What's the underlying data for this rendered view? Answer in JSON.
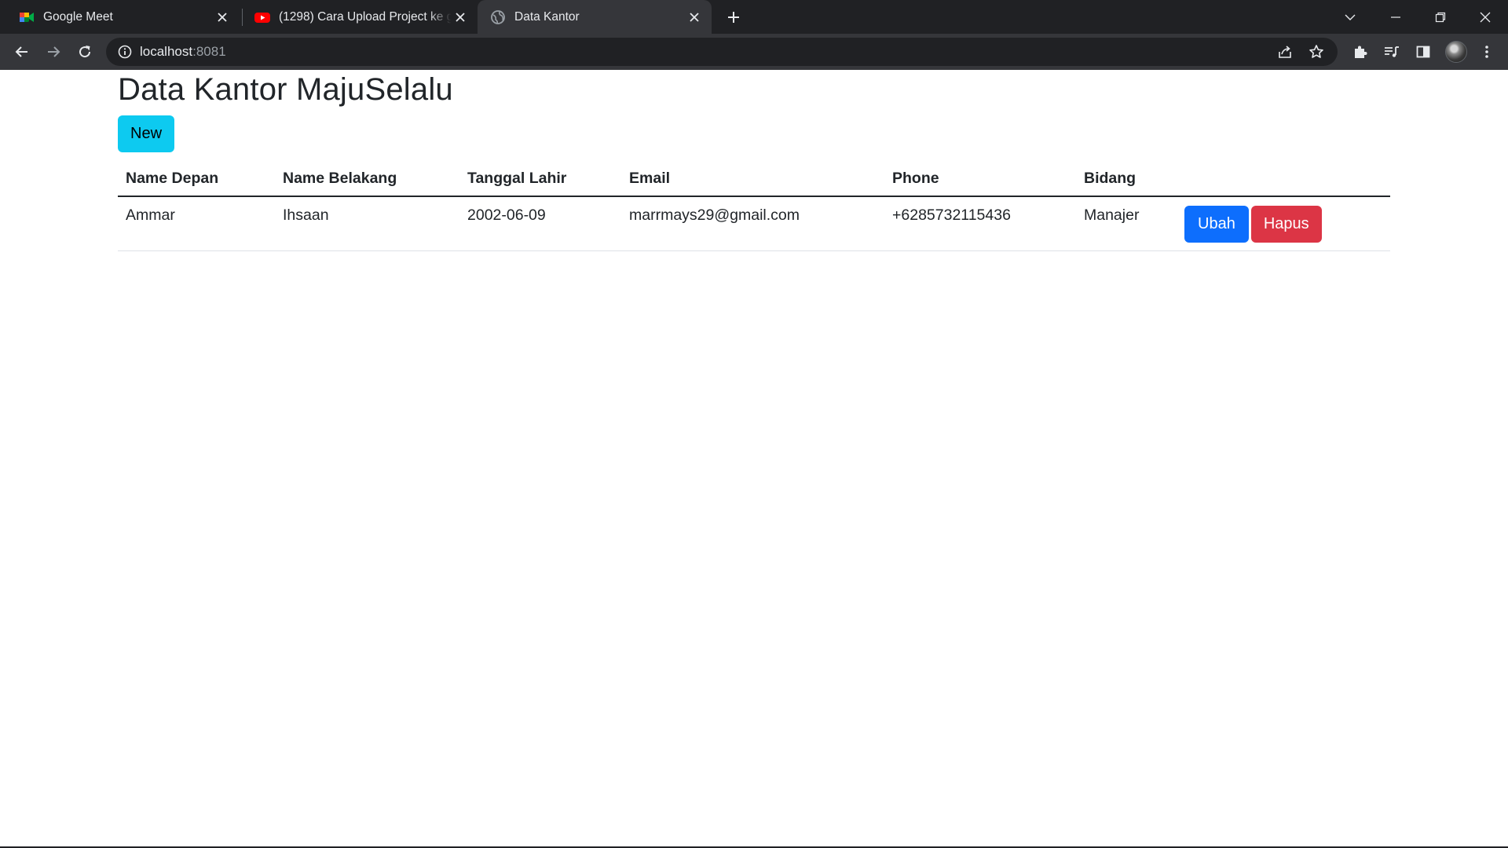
{
  "browser": {
    "tabs": [
      {
        "title": "Google Meet",
        "icon": "google-meet-icon",
        "active": false
      },
      {
        "title": "(1298) Cara Upload Project ke github",
        "icon": "youtube-icon",
        "active": false
      },
      {
        "title": "Data Kantor",
        "icon": "globe-icon",
        "active": true
      }
    ],
    "url_host": "localhost",
    "url_port": ":8081",
    "colors": {
      "frame": "#202124",
      "toolbar": "#35363a",
      "text": "#e8eaed"
    }
  },
  "page": {
    "title": "Data Kantor MajuSelalu",
    "new_button": "New",
    "table": {
      "headers": [
        "Name Depan",
        "Name Belakang",
        "Tanggal Lahir",
        "Email",
        "Phone",
        "Bidang",
        ""
      ],
      "rows": [
        {
          "name_depan": "Ammar",
          "name_belakang": "Ihsaan",
          "tanggal_lahir": "2002-06-09",
          "email": "marrmays29@gmail.com",
          "phone": "+6285732115436",
          "bidang": "Manajer",
          "edit_label": "Ubah",
          "delete_label": "Hapus"
        }
      ]
    },
    "colors": {
      "new": "#0dcaf0",
      "edit": "#0d6efd",
      "delete": "#dc3545"
    }
  }
}
